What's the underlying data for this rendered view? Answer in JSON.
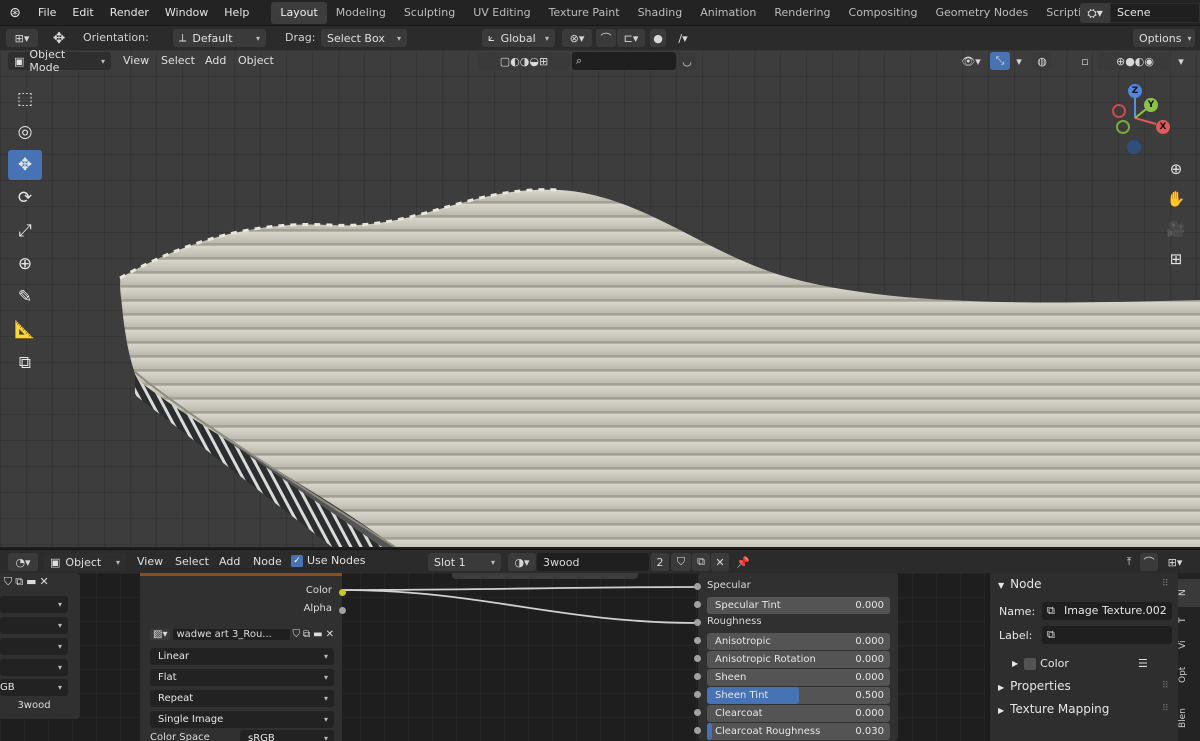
{
  "menu": [
    "File",
    "Edit",
    "Render",
    "Window",
    "Help"
  ],
  "workspaces": [
    {
      "label": "Layout",
      "active": true
    },
    {
      "label": "Modeling",
      "active": false
    },
    {
      "label": "Sculpting",
      "active": false
    },
    {
      "label": "UV Editing",
      "active": false
    },
    {
      "label": "Texture Paint",
      "active": false
    },
    {
      "label": "Shading",
      "active": false
    },
    {
      "label": "Animation",
      "active": false
    },
    {
      "label": "Rendering",
      "active": false
    },
    {
      "label": "Compositing",
      "active": false
    },
    {
      "label": "Geometry Nodes",
      "active": false
    },
    {
      "label": "Scripting",
      "active": false
    }
  ],
  "add_tab": "+",
  "scene": {
    "value": "Scene"
  },
  "tool_header": {
    "orientation_label": "Orientation:",
    "orientation_value": "Default",
    "drag_label": "Drag:",
    "drag_value": "Select Box",
    "transform_orientation": "Global",
    "options": "Options"
  },
  "viewport_header": {
    "mode": "Object Mode",
    "menus": [
      "View",
      "Select",
      "Add",
      "Object"
    ]
  },
  "gizmo": {
    "z": "Z",
    "y": "Y",
    "x": "X"
  },
  "node_header": {
    "editor_type": "Object",
    "menus": [
      "View",
      "Select",
      "Add",
      "Node"
    ],
    "use_nodes": "Use Nodes",
    "slot": "Slot 1",
    "material": "3wood",
    "users": "2"
  },
  "image_node": {
    "out_color": "Color",
    "out_alpha": "Alpha",
    "image_name": "wadwe art 3_Rou...",
    "interpolation": "Linear",
    "projection": "Flat",
    "extension": "Repeat",
    "source": "Single Image",
    "color_space_label": "Color Space",
    "color_space": "sRGB"
  },
  "left_node": {
    "partial": "GB",
    "material": "3wood"
  },
  "bsdf": {
    "specular": "Specular",
    "roughness": "Roughness",
    "fields": [
      {
        "label": "Specular Tint",
        "value": "0.000",
        "fill": 0
      },
      {
        "label": "Anisotropic",
        "value": "0.000",
        "fill": 0
      },
      {
        "label": "Anisotropic Rotation",
        "value": "0.000",
        "fill": 0
      },
      {
        "label": "Sheen",
        "value": "0.000",
        "fill": 0
      },
      {
        "label": "Sheen Tint",
        "value": "0.500",
        "fill": 0.5
      },
      {
        "label": "Clearcoat",
        "value": "0.000",
        "fill": 0
      },
      {
        "label": "Clearcoat Roughness",
        "value": "0.030",
        "fill": 0.03
      }
    ]
  },
  "side_panel": {
    "section": "Node",
    "name_label": "Name:",
    "name_value": "Image Texture.002",
    "label_label": "Label:",
    "label_value": "",
    "color": "Color",
    "properties": "Properties",
    "texture_mapping": "Texture Mapping"
  },
  "side_tabs": [
    "N",
    "T",
    "Vi",
    "Opt",
    "Blen"
  ]
}
